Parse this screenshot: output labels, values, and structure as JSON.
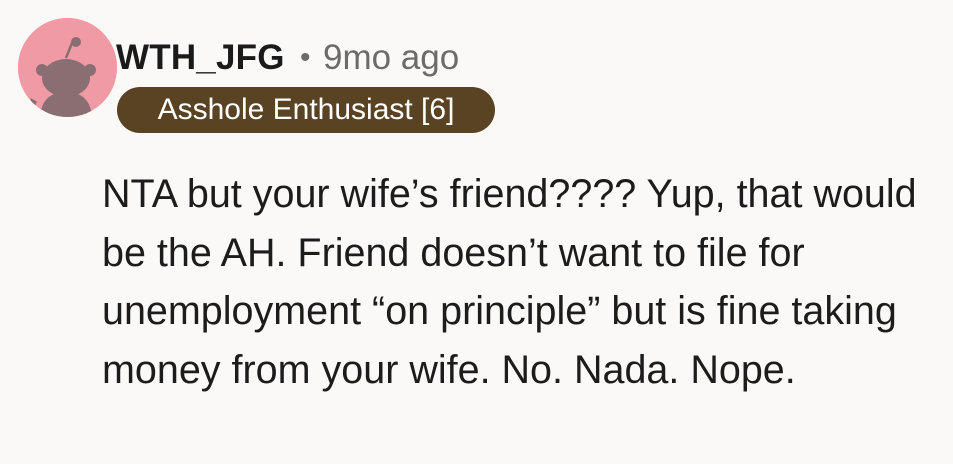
{
  "comment": {
    "author": {
      "username": "WTH_JFG",
      "avatar_icon": "reddit-snoo-avatar-icon",
      "avatar_bg_color": "#f09aa6",
      "flair": "Asshole Enthusiast [6]",
      "flair_bg_color": "#5a4322"
    },
    "separator": "•",
    "timestamp": "9mo ago",
    "body": "NTA but your wife’s friend???? Yup, that would be the AH. Friend doesn’t want to file for unemployment “on principle” but is fine taking money from your wife. No. Nada. Nope."
  }
}
